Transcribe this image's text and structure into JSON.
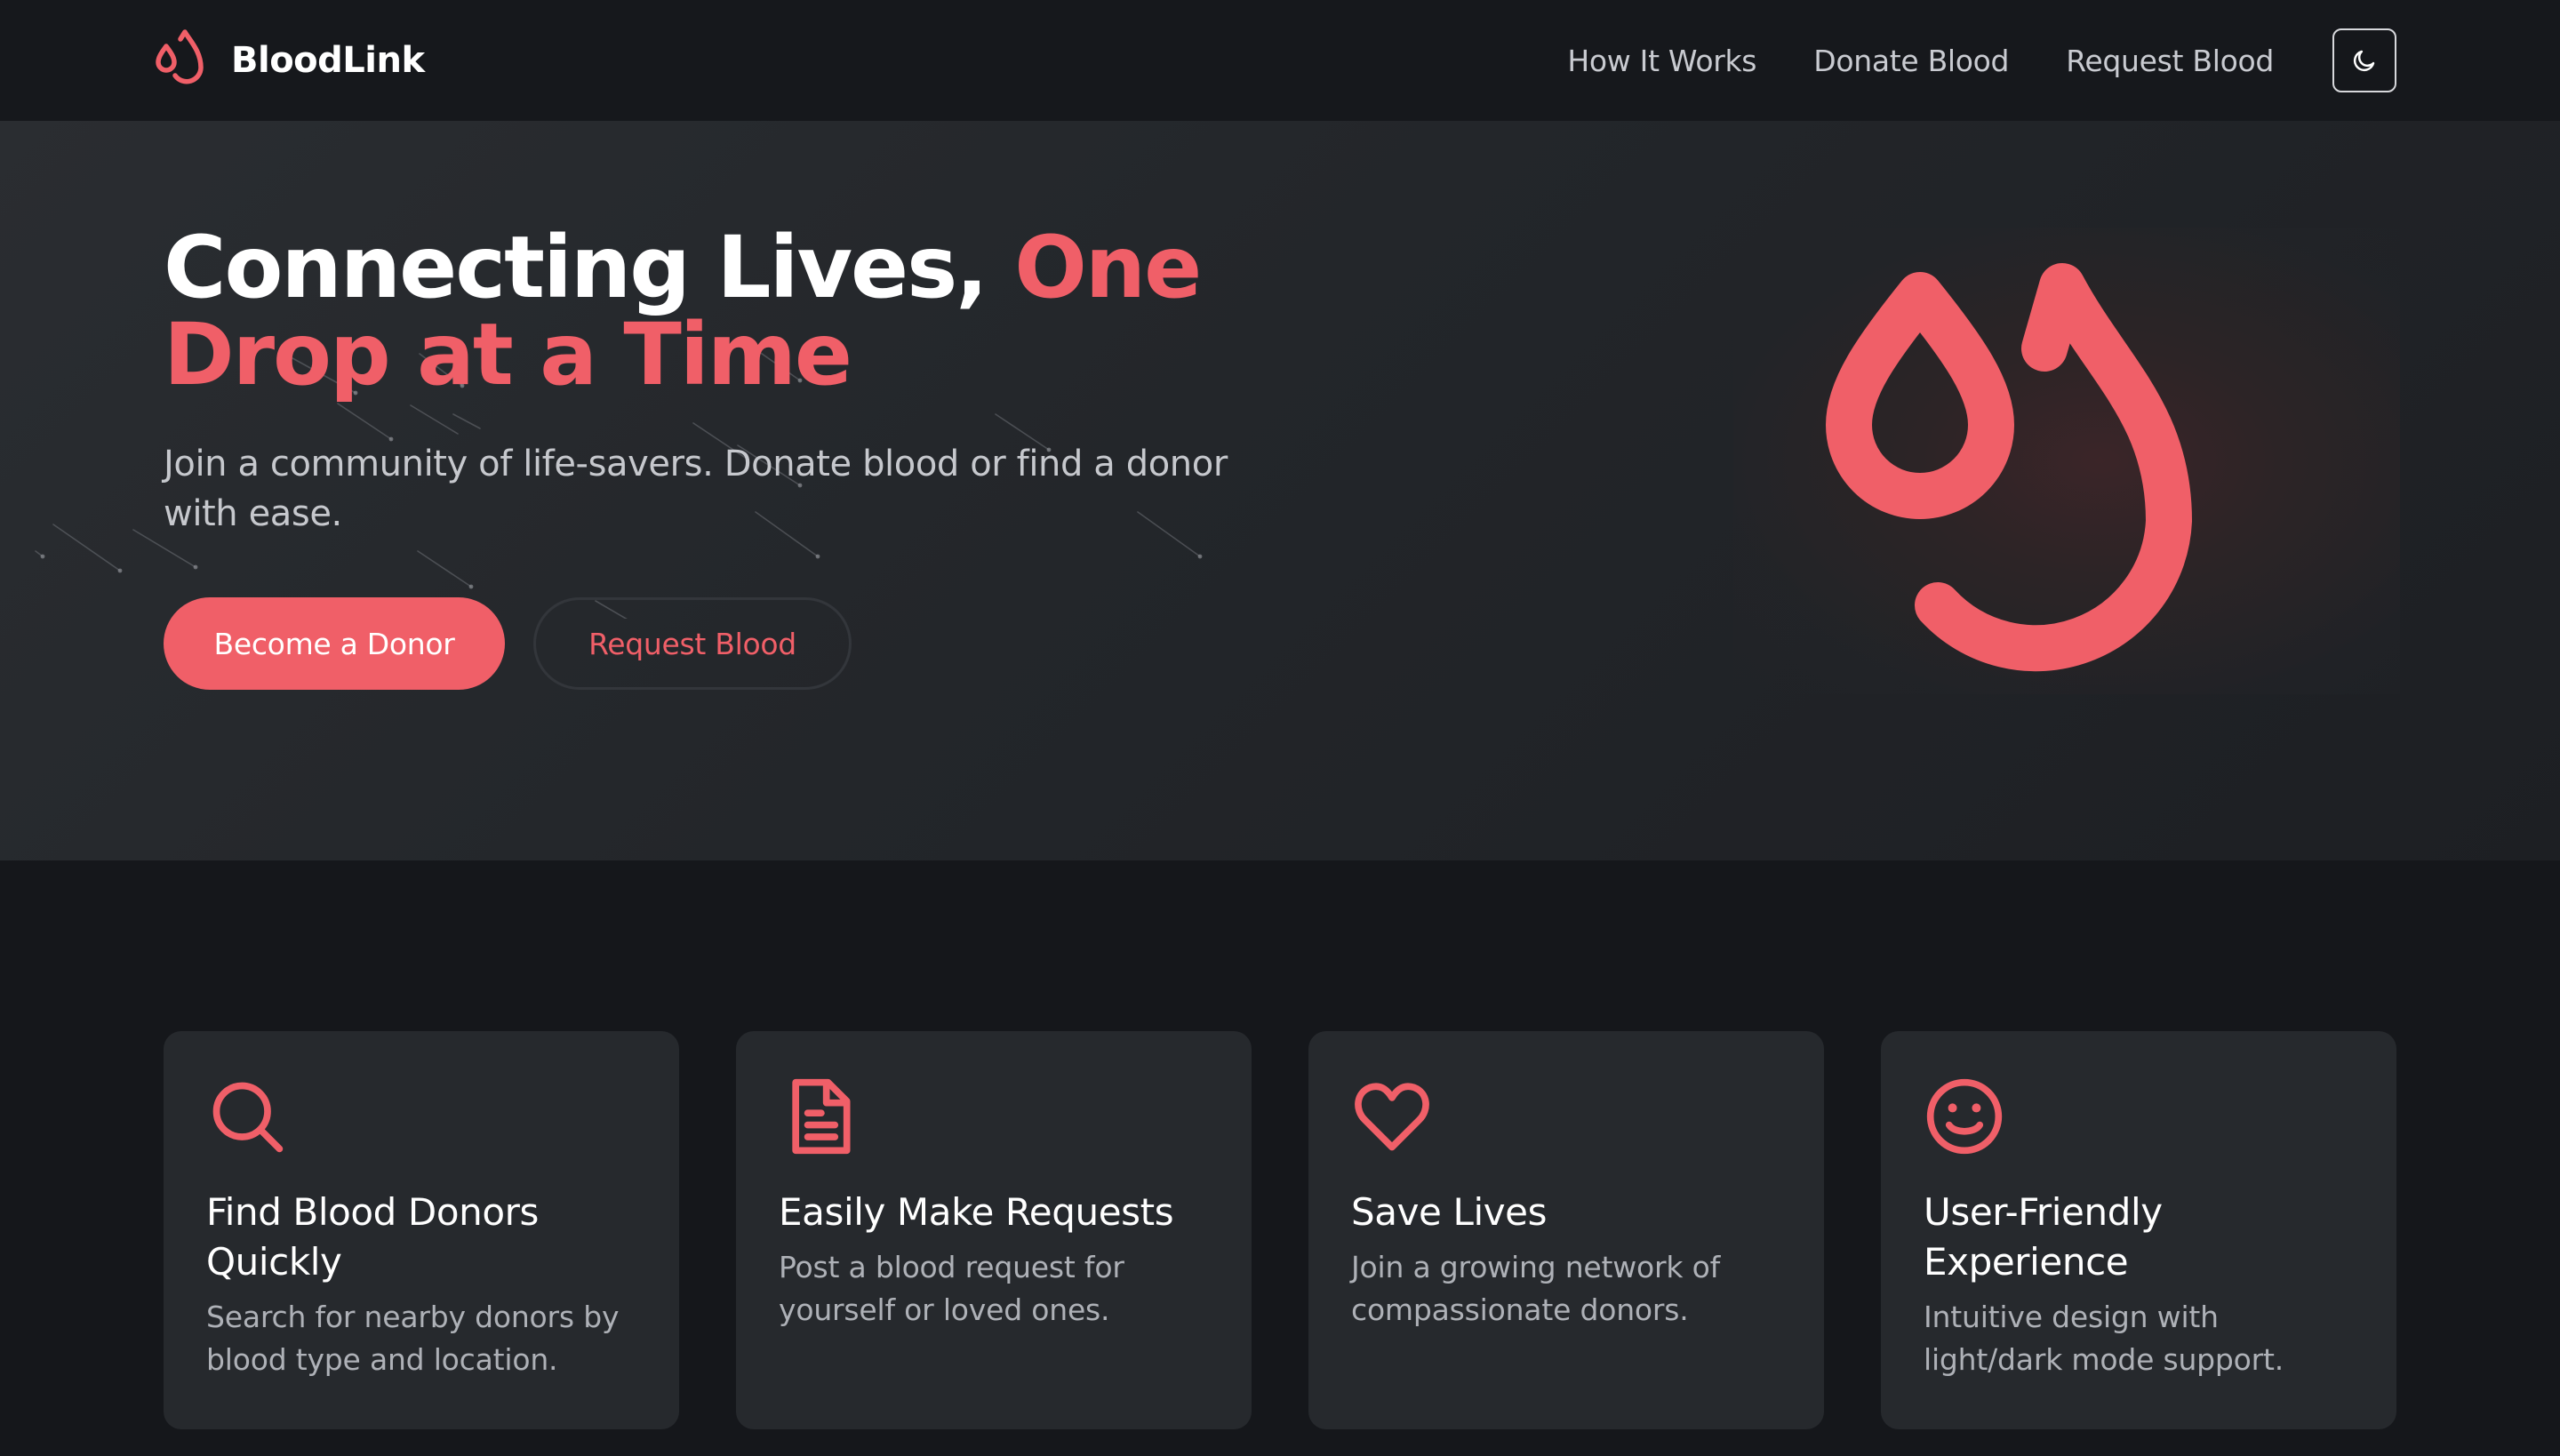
{
  "brand": {
    "name": "BloodLink",
    "logo_icon": "blood-drops-icon"
  },
  "nav": {
    "links": [
      "How It Works",
      "Donate Blood",
      "Request Blood"
    ],
    "theme_toggle_icon": "moon-icon"
  },
  "hero": {
    "title_part1": "Connecting Lives, ",
    "title_accent": "One Drop at a Time",
    "subtitle": "Join a community of life-savers. Donate blood or find a donor with ease.",
    "primary_button": "Become a Donor",
    "secondary_button": "Request Blood",
    "illustration_icon": "blood-drops-icon"
  },
  "features": [
    {
      "icon": "search-icon",
      "title": "Find Blood Donors Quickly",
      "description": "Search for nearby donors by blood type and location."
    },
    {
      "icon": "document-icon",
      "title": "Easily Make Requests",
      "description": "Post a blood request for yourself or loved ones."
    },
    {
      "icon": "heart-icon",
      "title": "Save Lives",
      "description": "Join a growing network of compassionate donors."
    },
    {
      "icon": "smiley-icon",
      "title": "User-Friendly Experience",
      "description": "Intuitive design with light/dark mode support."
    }
  ],
  "colors": {
    "accent": "#f05f68",
    "background": "#15171b",
    "card": "#26292d",
    "hero": "#25282c"
  }
}
